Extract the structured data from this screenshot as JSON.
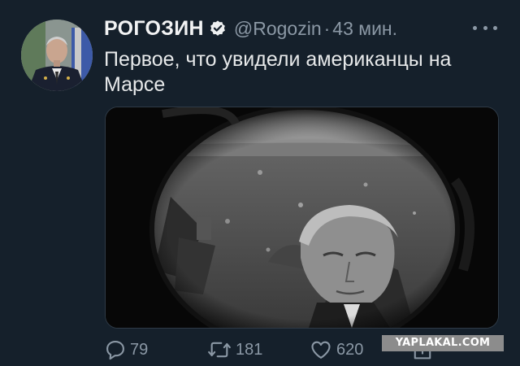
{
  "tweet": {
    "display_name": "РОГОЗИН",
    "handle": "@Rogozin",
    "separator": "·",
    "time": "43 мин.",
    "verified": true,
    "text": "Первое, что увидели американцы на Марсе"
  },
  "icons": {
    "verified": "verified-badge-icon",
    "more": "more-options-icon",
    "reply": "reply-icon",
    "retweet": "retweet-icon",
    "like": "heart-icon",
    "share": "share-icon"
  },
  "actions": {
    "replies": "79",
    "retweets": "181",
    "likes": "620"
  },
  "watermark": "YAPLAKAL.COM",
  "colors": {
    "background": "#15202b",
    "text_primary": "#e7e9ea",
    "text_secondary": "#8b98a5"
  }
}
